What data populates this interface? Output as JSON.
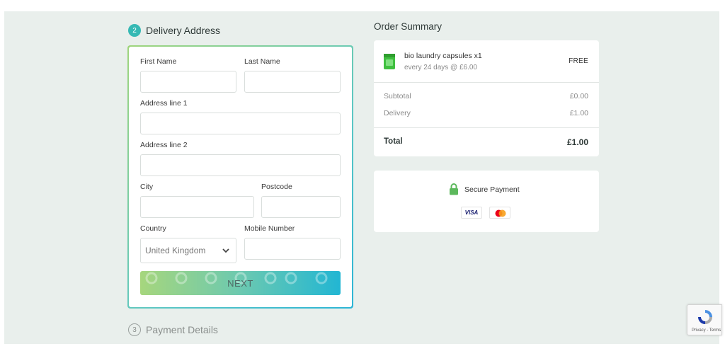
{
  "steps": {
    "delivery": {
      "number": "2",
      "label": "Delivery Address"
    },
    "payment": {
      "number": "3",
      "label": "Payment Details"
    }
  },
  "form": {
    "first_name": {
      "label": "First Name",
      "value": "",
      "placeholder": ""
    },
    "last_name": {
      "label": "Last Name",
      "value": "",
      "placeholder": ""
    },
    "address1": {
      "label": "Address line 1",
      "value": "",
      "placeholder": ""
    },
    "address2": {
      "label": "Address line 2",
      "value": "",
      "placeholder": ""
    },
    "city": {
      "label": "City",
      "value": "",
      "placeholder": ""
    },
    "postcode": {
      "label": "Postcode",
      "value": "",
      "placeholder": ""
    },
    "country": {
      "label": "Country",
      "selected": "United Kingdom"
    },
    "mobile": {
      "label": "Mobile Number",
      "value": "",
      "placeholder": ""
    },
    "next_label": "NEXT"
  },
  "summary": {
    "title": "Order Summary",
    "product": {
      "name": "bio laundry capsules x1",
      "subscription": "every 24 days @ £6.00",
      "price": "FREE",
      "icon": "product-pouch-icon"
    },
    "rows": [
      {
        "label": "Subtotal",
        "value": "£0.00"
      },
      {
        "label": "Delivery",
        "value": "£1.00"
      }
    ],
    "total": {
      "label": "Total",
      "value": "£1.00"
    }
  },
  "secure": {
    "text": "Secure Payment",
    "icon": "lock-icon",
    "cards": {
      "visa": "VISA",
      "mastercard": "mastercard-icon"
    }
  },
  "recaptcha": {
    "text": "Privacy - Terms"
  },
  "colors": {
    "accent": "#36b9b4",
    "gradient_start": "#a6d67d",
    "gradient_end": "#22b6d3",
    "background": "#e9efec"
  }
}
